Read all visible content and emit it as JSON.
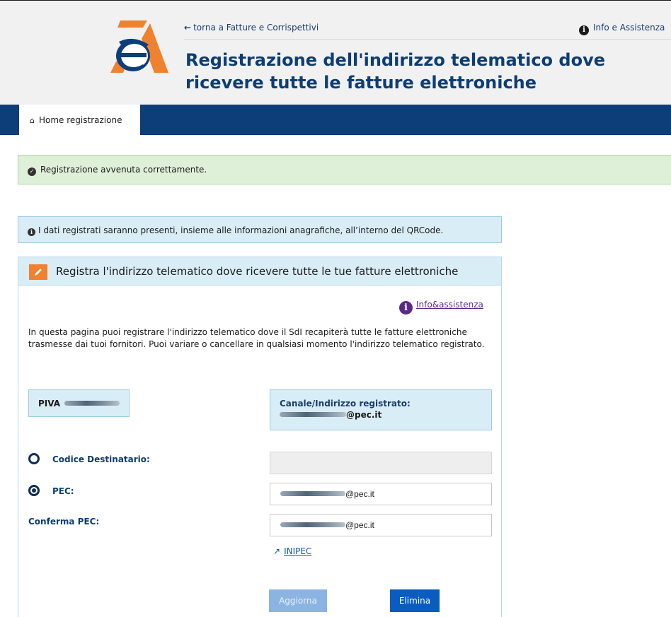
{
  "header": {
    "back_link": "torna a Fatture e Corrispettivi",
    "info_link": "Info e Assistenza",
    "title": "Registrazione dell'indirizzo telematico dove ricevere tutte le fatture elettroniche"
  },
  "nav": {
    "home_label": "Home registrazione"
  },
  "alerts": {
    "success": "Registrazione avvenuta correttamente.",
    "info": "I dati registrati saranno presenti, insieme alle informazioni anagrafiche, all’interno del QRCode."
  },
  "panel": {
    "title": "Registra l'indirizzo telematico dove ricevere tutte le tue fatture elettroniche",
    "info_assist": "Info&assistenza",
    "description": "In questa pagina puoi registrare l'indirizzo telematico dove il SdI recapiterà tutte le fatture elettroniche trasmesse dai tuoi fornitori. Puoi variare o cancellare in qualsiasi momento l'indirizzo telematico registrato.",
    "piva_label": "PIVA",
    "canale_label": "Canale/Indirizzo registrato:",
    "canale_value_suffix": "@pec.it",
    "codice_label": "Codice Destinatario:",
    "pec_label": "PEC:",
    "conferma_label": "Conferma PEC:",
    "pec_value_suffix": "@pec.it",
    "conferma_value_suffix": "@pec.it",
    "inipec_link": "INIPEC",
    "aggiorna_label": "Aggiorna",
    "elimina_label": "Elimina"
  },
  "state": {
    "selected_channel": "PEC"
  },
  "colors": {
    "brand_blue": "#0e3e7a",
    "title_blue": "#0d3d75",
    "accent_orange": "#f0812f",
    "success_bg": "#dff0d8",
    "info_bg": "#d9edf7",
    "button_primary": "#0a5cbf",
    "button_disabled": "#8cb4e2",
    "link_purple": "#5b2a86"
  },
  "icons": {
    "logo": "agenzia-entrate-logo",
    "back": "arrow-left-icon",
    "info": "info-circle-icon",
    "home": "home-icon",
    "success": "check-circle-icon",
    "edit": "pencil-icon",
    "external": "external-link-icon"
  }
}
